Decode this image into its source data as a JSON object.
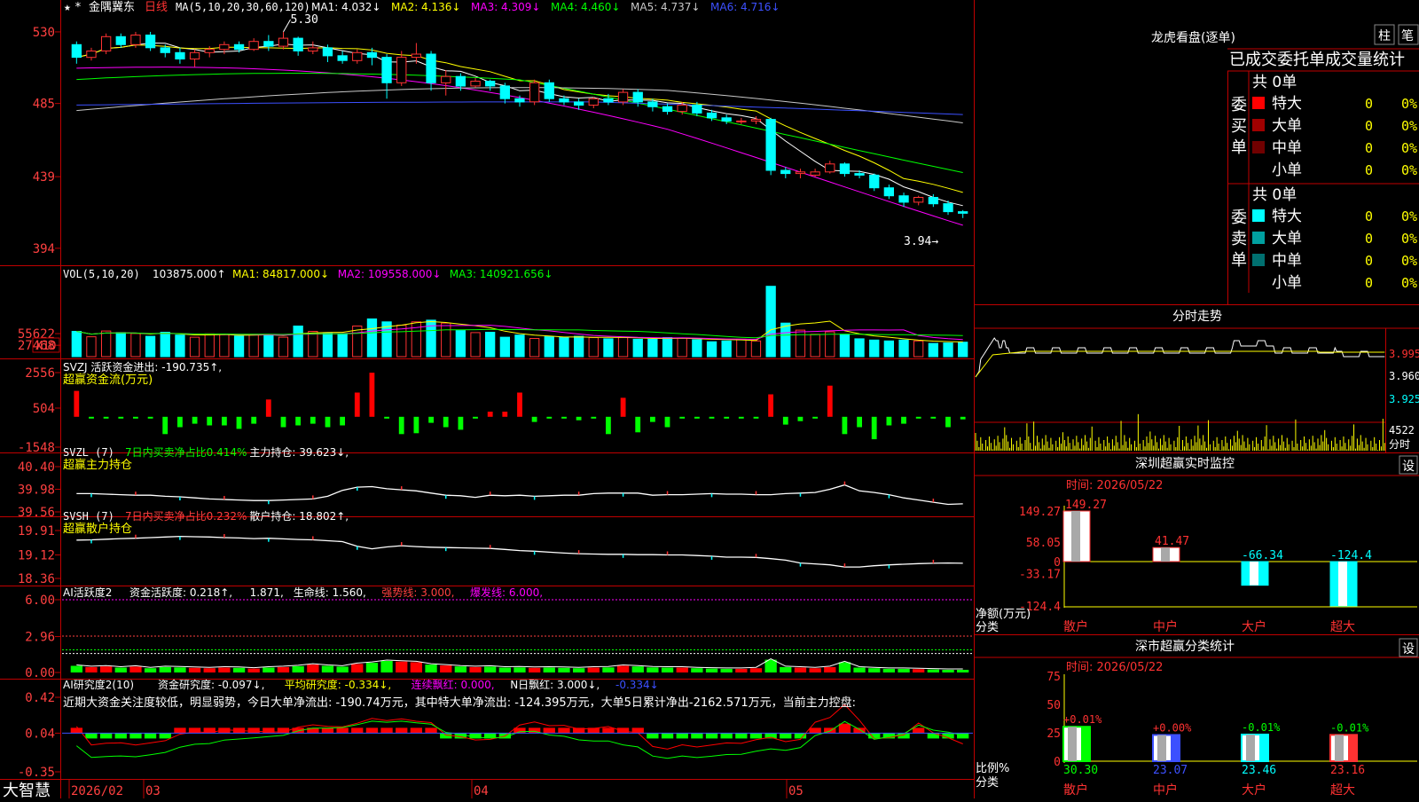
{
  "colors": {
    "up": "#ff3232",
    "down": "#00ffff",
    "border": "#c00000",
    "label_red": "#ff4040",
    "yellow": "#ffff00",
    "magenta": "#ff00ff",
    "green": "#00ff00",
    "blue": "#4040ff",
    "white": "#ffffff",
    "dividerRed": "#c80000"
  },
  "header": {
    "stock_name": "金隅冀东",
    "period": "日线",
    "ma_label": "MA(5,10,20,30,60,120)",
    "ma_items": [
      {
        "text": "MA1: 4.032↓",
        "color": "#ffffff"
      },
      {
        "text": "MA2: 4.136↓",
        "color": "#ffff00"
      },
      {
        "text": "MA3: 4.309↓",
        "color": "#ff00ff"
      },
      {
        "text": "MA4: 4.460↓",
        "color": "#00ff00"
      },
      {
        "text": "MA5: 4.737↓",
        "color": "#c8c8c8"
      },
      {
        "text": "MA6: 4.716↓",
        "color": "#3c50ff"
      }
    ],
    "high_label": "5.30",
    "low_label": "3.94"
  },
  "price_axis": [
    "530",
    "485",
    "439",
    "394"
  ],
  "vol_panel": {
    "title": "VOL(5,10,20)",
    "items": [
      {
        "text": "103875.000↑",
        "color": "#ffffff"
      },
      {
        "text": "MA1: 84817.000↓",
        "color": "#ffff00"
      },
      {
        "text": "MA2: 109558.000↓",
        "color": "#ff00ff"
      },
      {
        "text": "MA3: 140921.656↓",
        "color": "#00ff00"
      }
    ],
    "axis": [
      "55622",
      "27468"
    ],
    "unit": "X10"
  },
  "svzj_panel": {
    "title": "SVZJ  活跃资金进出: -190.735↑,",
    "subtitle": "超赢资金流(万元)",
    "axis": [
      "2556",
      "504",
      "-1548"
    ]
  },
  "svzl_panel": {
    "title": "SVZL (7)",
    "items": [
      {
        "text": "7日内买卖净占比0.414%",
        "color": "#00ff00"
      },
      {
        "text": "主力持仓: 39.623↓,",
        "color": "#ffffff"
      }
    ],
    "subtitle": "超赢主力持仓",
    "axis": [
      "40.40",
      "39.98",
      "39.56"
    ]
  },
  "svsh_panel": {
    "title": "SVSH (7)",
    "items": [
      {
        "text": "7日内买卖净占比0.232%",
        "color": "#ff4040"
      },
      {
        "text": "散户持仓: 18.802↑,",
        "color": "#ffffff"
      }
    ],
    "subtitle": "超赢散户持仓",
    "axis": [
      "19.91",
      "19.12",
      "18.36"
    ]
  },
  "ai_active_panel": {
    "title": "AI活跃度2",
    "items": [
      {
        "text": "资金活跃度: 0.218↑,",
        "color": "#ffffff"
      },
      {
        "text": "1.871,",
        "color": "#ffffff"
      },
      {
        "text": "生命线: 1.560,",
        "color": "#ffffff"
      },
      {
        "text": "强势线: 3.000,",
        "color": "#ff4040"
      },
      {
        "text": "爆发线: 6.000,",
        "color": "#ff00ff"
      }
    ],
    "axis": [
      "6.00",
      "2.96",
      "0.00"
    ]
  },
  "ai_research_panel": {
    "title": "AI研究度2(10)",
    "items": [
      {
        "text": "资金研究度: -0.097↓,",
        "color": "#ffffff"
      },
      {
        "text": "平均研究度: -0.334↓,",
        "color": "#ffff00"
      },
      {
        "text": "连续飘红: 0.000,",
        "color": "#ff00ff"
      },
      {
        "text": "N日飘红: 3.000↓,",
        "color": "#ffffff"
      },
      {
        "text": "-0.334↓",
        "color": "#3c50ff"
      }
    ],
    "note": "近期大资金关注度较低，明显弱势，今日大单净流出: -190.74万元，其中特大单净流出: -124.395万元，大单5日累计净出-2162.571万元，当前主力控盘:",
    "axis": [
      "0.42",
      "0.04",
      "-0.35"
    ]
  },
  "date_axis": {
    "labels": [
      "2026/02",
      "03",
      "04",
      "05"
    ],
    "brand": "大智慧"
  },
  "dragon_tiger": {
    "title": "龙虎看盘(逐单)",
    "btn1": "柱",
    "btn2": "笔",
    "header": "已成交委托单成交量统计",
    "buy_side": "委买单",
    "sell_side": "委卖单",
    "buy_total": "共 0单",
    "sell_total": "共 0单",
    "buy_rows": [
      {
        "label": "特大",
        "count": "0",
        "pct": "0%",
        "swatch": "#ff0000"
      },
      {
        "label": "大单",
        "count": "0",
        "pct": "0%",
        "swatch": "#a00000"
      },
      {
        "label": "中单",
        "count": "0",
        "pct": "0%",
        "swatch": "#700000"
      },
      {
        "label": "小单",
        "count": "0",
        "pct": "0%",
        "swatch": ""
      }
    ],
    "sell_rows": [
      {
        "label": "特大",
        "count": "0",
        "pct": "0%",
        "swatch": "#00ffff"
      },
      {
        "label": "大单",
        "count": "0",
        "pct": "0%",
        "swatch": "#00a0a0"
      },
      {
        "label": "中单",
        "count": "0",
        "pct": "0%",
        "swatch": "#007070"
      },
      {
        "label": "小单",
        "count": "0",
        "pct": "0%",
        "swatch": ""
      }
    ]
  },
  "intraday": {
    "title": "分时走势",
    "axis": [
      "3.995",
      "3.960",
      "3.925"
    ],
    "vol_label": "4522",
    "vol_unit": "分时"
  },
  "sz_monitor": {
    "title": "深圳超赢实时监控",
    "settings": "设",
    "time": "时间: 2026/05/22",
    "axis": [
      "149.27",
      "58.05",
      "0",
      "-33.17",
      "-124.4"
    ],
    "ylabel": "净额(万元)",
    "xlabel": "分类",
    "bars": [
      {
        "category": "散户",
        "value": 149.27,
        "label": "149.27"
      },
      {
        "category": "中户",
        "value": 41.47,
        "label": "41.47"
      },
      {
        "category": "大户",
        "value": -66.34,
        "label": "-66.34"
      },
      {
        "category": "超大",
        "value": -124.4,
        "label": "-124.4"
      }
    ]
  },
  "sz_category": {
    "title": "深市超赢分类统计",
    "settings": "设",
    "time": "时间: 2026/05/22",
    "axis": [
      "75",
      "50",
      "25",
      "0"
    ],
    "ylabel": "比例%",
    "xlabel": "分类",
    "bars": [
      {
        "category": "散户",
        "value": 30.3,
        "label": "30.30",
        "delta": "+0.01%",
        "color": "#00ff00"
      },
      {
        "category": "中户",
        "value": 23.07,
        "label": "23.07",
        "delta": "+0.00%",
        "color": "#3c50ff"
      },
      {
        "category": "大户",
        "value": 23.46,
        "label": "23.46",
        "delta": "-0.01%",
        "color": "#00ffff"
      },
      {
        "category": "超大",
        "value": 23.16,
        "label": "23.16",
        "delta": "-0.01%",
        "color": "#ff3232"
      }
    ]
  },
  "chart_data": [
    {
      "type": "candlestick",
      "ylim": [
        3.85,
        5.4
      ],
      "candles": [
        [
          5.22,
          5.14,
          5.24,
          5.1
        ],
        [
          5.14,
          5.18,
          5.2,
          5.12
        ],
        [
          5.18,
          5.27,
          5.29,
          5.16
        ],
        [
          5.27,
          5.22,
          5.29,
          5.2
        ],
        [
          5.22,
          5.28,
          5.3,
          5.2
        ],
        [
          5.28,
          5.2,
          5.3,
          5.18
        ],
        [
          5.2,
          5.17,
          5.22,
          5.14
        ],
        [
          5.17,
          5.13,
          5.2,
          5.1
        ],
        [
          5.13,
          5.17,
          5.19,
          5.08
        ],
        [
          5.17,
          5.19,
          5.21,
          5.14
        ],
        [
          5.19,
          5.22,
          5.24,
          5.16
        ],
        [
          5.22,
          5.19,
          5.24,
          5.17
        ],
        [
          5.19,
          5.24,
          5.26,
          5.18
        ],
        [
          5.24,
          5.21,
          5.28,
          5.18
        ],
        [
          5.21,
          5.26,
          5.3,
          5.19
        ],
        [
          5.26,
          5.18,
          5.27,
          5.15
        ],
        [
          5.18,
          5.2,
          5.24,
          5.16
        ],
        [
          5.2,
          5.15,
          5.22,
          5.11
        ],
        [
          5.15,
          5.12,
          5.18,
          5.1
        ],
        [
          5.12,
          5.17,
          5.19,
          5.1
        ],
        [
          5.17,
          5.14,
          5.2,
          5.09
        ],
        [
          5.14,
          4.98,
          5.16,
          4.88
        ],
        [
          4.98,
          5.14,
          5.18,
          4.96
        ],
        [
          5.14,
          5.16,
          5.23,
          5.1
        ],
        [
          5.16,
          4.98,
          5.18,
          4.93
        ],
        [
          4.98,
          5.02,
          5.06,
          4.9
        ],
        [
          5.02,
          4.96,
          5.04,
          4.93
        ],
        [
          4.96,
          4.99,
          5.01,
          4.95
        ],
        [
          4.99,
          4.96,
          5.0,
          4.93
        ],
        [
          4.96,
          4.88,
          4.98,
          4.85
        ],
        [
          4.88,
          4.86,
          4.9,
          4.83
        ],
        [
          4.86,
          4.98,
          5.0,
          4.84
        ],
        [
          4.98,
          4.88,
          5.0,
          4.86
        ],
        [
          4.88,
          4.86,
          4.9,
          4.84
        ],
        [
          4.86,
          4.84,
          4.88,
          4.81
        ],
        [
          4.84,
          4.88,
          4.89,
          4.82
        ],
        [
          4.88,
          4.86,
          4.91,
          4.84
        ],
        [
          4.86,
          4.92,
          4.94,
          4.84
        ],
        [
          4.92,
          4.86,
          4.94,
          4.83
        ],
        [
          4.86,
          4.83,
          4.88,
          4.8
        ],
        [
          4.83,
          4.8,
          4.85,
          4.78
        ],
        [
          4.8,
          4.84,
          4.86,
          4.78
        ],
        [
          4.84,
          4.79,
          4.86,
          4.77
        ],
        [
          4.79,
          4.76,
          4.81,
          4.74
        ],
        [
          4.76,
          4.74,
          4.78,
          4.72
        ],
        [
          4.74,
          4.74,
          4.76,
          4.72
        ],
        [
          4.74,
          4.75,
          4.77,
          4.72
        ],
        [
          4.75,
          4.43,
          4.76,
          4.4
        ],
        [
          4.43,
          4.41,
          4.45,
          4.38
        ],
        [
          4.41,
          4.42,
          4.44,
          4.38
        ],
        [
          4.4,
          4.42,
          4.44,
          4.39
        ],
        [
          4.42,
          4.47,
          4.49,
          4.41
        ],
        [
          4.47,
          4.41,
          4.48,
          4.39
        ],
        [
          4.41,
          4.4,
          4.43,
          4.38
        ],
        [
          4.4,
          4.32,
          4.41,
          4.3
        ],
        [
          4.32,
          4.27,
          4.34,
          4.25
        ],
        [
          4.27,
          4.23,
          4.29,
          4.2
        ],
        [
          4.23,
          4.26,
          4.27,
          4.21
        ],
        [
          4.26,
          4.22,
          4.28,
          4.2
        ],
        [
          4.22,
          4.17,
          4.24,
          4.15
        ],
        [
          4.17,
          4.16,
          4.18,
          4.13
        ]
      ]
    },
    {
      "type": "bar",
      "name": "VOL",
      "values": [
        61000,
        48000,
        62000,
        58000,
        56000,
        49000,
        59000,
        52000,
        47000,
        55000,
        54000,
        50000,
        53000,
        52000,
        47000,
        74000,
        61000,
        57000,
        55000,
        74000,
        91000,
        84000,
        76000,
        84000,
        88000,
        81000,
        63000,
        58000,
        59000,
        47000,
        52000,
        44000,
        48000,
        46000,
        49000,
        46000,
        43000,
        47000,
        42000,
        42000,
        46000,
        45000,
        41000,
        36000,
        38000,
        42000,
        38000,
        170000,
        81000,
        64000,
        54000,
        60000,
        54000,
        43000,
        40000,
        38000,
        40000,
        38000,
        32000,
        33000,
        35000
      ]
    },
    {
      "type": "bar",
      "name": "SVZJ",
      "ylim": [
        -1548,
        2556
      ],
      "values": [
        1500,
        -100,
        -100,
        -60,
        -80,
        -60,
        -1000,
        -600,
        -400,
        -500,
        -500,
        -700,
        -400,
        1000,
        -600,
        -500,
        -400,
        -600,
        -500,
        1400,
        2550,
        -50,
        -1000,
        -950,
        -350,
        -600,
        -750,
        -50,
        300,
        300,
        1400,
        -300,
        -50,
        -50,
        -200,
        -100,
        -1000,
        1100,
        -900,
        -300,
        -600,
        -100,
        -100,
        -100,
        -50,
        -100,
        -50,
        1300,
        -450,
        -250,
        -100,
        1800,
        -1000,
        -600,
        -1300,
        -500,
        -400,
        -100,
        -100,
        -600,
        -150
      ]
    },
    {
      "type": "line",
      "name": "主力持仓",
      "ylim": [
        39.56,
        40.4
      ],
      "values": [
        39.9,
        39.9,
        39.89,
        39.88,
        39.87,
        39.87,
        39.85,
        39.84,
        39.82,
        39.8,
        39.79,
        39.78,
        39.77,
        39.77,
        39.78,
        39.79,
        39.8,
        39.85,
        39.96,
        40.02,
        40.03,
        39.99,
        39.97,
        39.95,
        39.91,
        39.87,
        39.86,
        39.83,
        39.87,
        39.86,
        39.87,
        39.85,
        39.86,
        39.87,
        39.87,
        39.9,
        39.91,
        39.91,
        39.91,
        39.87,
        39.88,
        39.88,
        39.89,
        39.9,
        39.89,
        39.89,
        39.88,
        39.88,
        39.9,
        39.91,
        39.92,
        39.98,
        40.06,
        39.95,
        39.92,
        39.88,
        39.82,
        39.78,
        39.74,
        39.7,
        39.71
      ]
    },
    {
      "type": "line",
      "name": "散户持仓",
      "ylim": [
        18.36,
        19.91
      ],
      "values": [
        19.6,
        19.61,
        19.63,
        19.65,
        19.66,
        19.68,
        19.7,
        19.72,
        19.71,
        19.7,
        19.68,
        19.67,
        19.65,
        19.66,
        19.64,
        19.62,
        19.61,
        19.58,
        19.55,
        19.4,
        19.32,
        19.38,
        19.42,
        19.39,
        19.37,
        19.36,
        19.35,
        19.34,
        19.33,
        19.3,
        19.26,
        19.24,
        19.21,
        19.18,
        19.16,
        19.15,
        19.14,
        19.14,
        19.13,
        19.13,
        19.12,
        19.12,
        19.1,
        19.08,
        19.05,
        19.05,
        19.04,
        19.0,
        18.95,
        18.86,
        18.83,
        18.8,
        18.73,
        18.73,
        18.77,
        18.8,
        18.82,
        18.84,
        18.85,
        18.86,
        18.85
      ]
    },
    {
      "type": "bar",
      "name": "AI活跃度",
      "ylim": [
        0,
        6.0
      ],
      "values": [
        0.55,
        0.45,
        0.5,
        0.4,
        0.48,
        0.35,
        0.45,
        0.42,
        0.38,
        0.35,
        0.4,
        0.38,
        0.32,
        0.4,
        0.45,
        0.52,
        0.65,
        0.55,
        0.48,
        0.7,
        0.8,
        0.95,
        0.9,
        0.85,
        0.65,
        0.58,
        0.5,
        0.45,
        0.48,
        0.4,
        0.42,
        0.38,
        0.4,
        0.38,
        0.35,
        0.4,
        0.42,
        0.55,
        0.5,
        0.42,
        0.4,
        0.4,
        0.35,
        0.32,
        0.3,
        0.3,
        0.35,
        1.05,
        0.45,
        0.4,
        0.35,
        0.45,
        0.85,
        0.4,
        0.35,
        0.3,
        0.3,
        0.28,
        0.25,
        0.22,
        0.22
      ]
    },
    {
      "type": "bar",
      "name": "AI研究度",
      "ylim": [
        -0.35,
        0.42
      ],
      "values": [
        0.05,
        -0.08,
        -0.06,
        -0.05,
        -0.06,
        -0.04,
        -0.02,
        0.03,
        0.05,
        0.04,
        0.06,
        0.05,
        0.04,
        0.03,
        0.02,
        0.05,
        0.06,
        0.04,
        0.03,
        0.05,
        0.08,
        0.06,
        0.07,
        0.05,
        0.04,
        -0.05,
        -0.06,
        -0.08,
        -0.07,
        -0.04,
        0.05,
        0.08,
        0.06,
        0.07,
        0.05,
        0.06,
        0.08,
        0.05,
        0.04,
        -0.06,
        -0.08,
        -0.05,
        -0.07,
        -0.06,
        -0.05,
        -0.06,
        -0.04,
        -0.03,
        -0.07,
        -0.06,
        0.06,
        0.09,
        0.18,
        0.06,
        -0.08,
        -0.07,
        -0.05,
        0.04,
        -0.03,
        -0.06,
        -0.1
      ]
    }
  ]
}
